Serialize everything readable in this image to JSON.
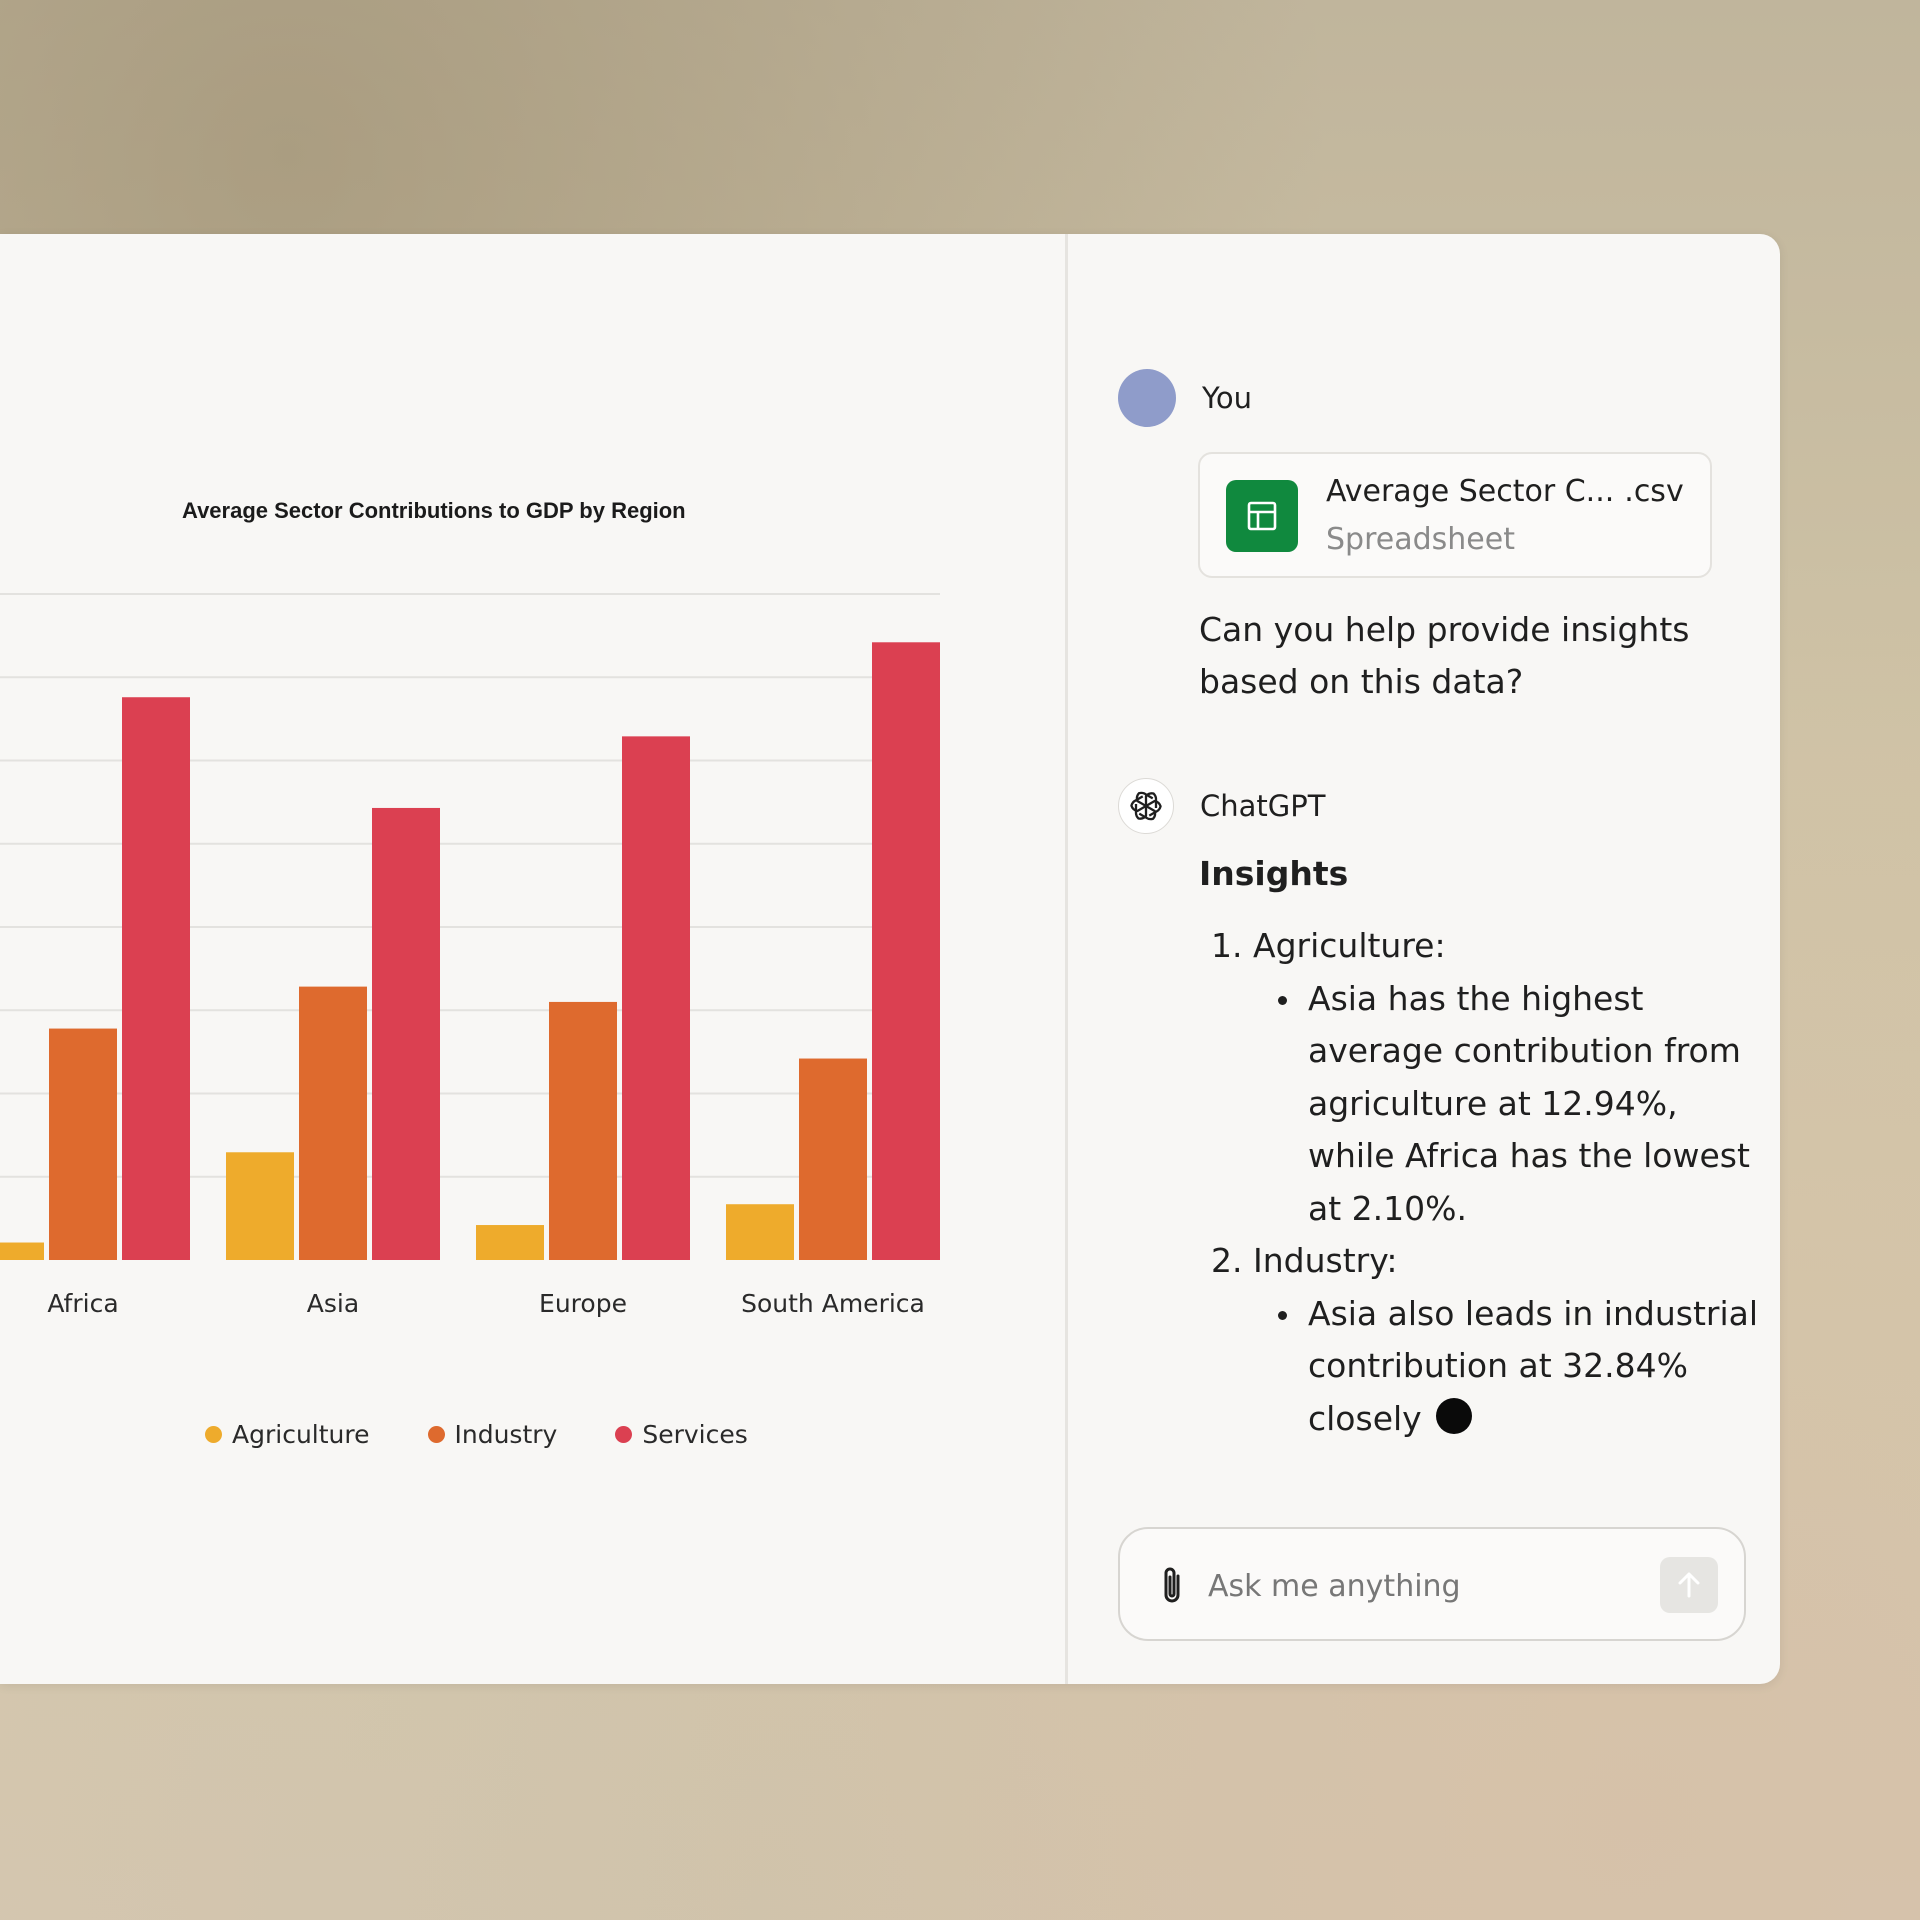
{
  "chart_data": {
    "type": "bar",
    "title": "Average Sector Contributions to GDP by Region",
    "categories": [
      "Africa",
      "Asia",
      "Europe",
      "South America"
    ],
    "series": [
      {
        "name": "Agriculture",
        "color": "#eeab2c",
        "values": [
          2.1,
          12.94,
          4.2,
          6.7
        ]
      },
      {
        "name": "Industry",
        "color": "#de6a2e",
        "values": [
          27.8,
          32.84,
          31.0,
          24.2
        ]
      },
      {
        "name": "Services",
        "color": "#db4051",
        "values": [
          67.6,
          54.3,
          62.9,
          74.2
        ]
      }
    ],
    "ylim": [
      0,
      80
    ],
    "grid": true,
    "legend_position": "bottom"
  },
  "chat": {
    "user": {
      "name": "You",
      "file": {
        "name": "Average Sector C...",
        "extension": ".csv",
        "type": "Spreadsheet",
        "icon": "spreadsheet-icon",
        "icon_color": "#10893e"
      },
      "message": "Can you help provide insights based on this data?"
    },
    "assistant": {
      "name": "ChatGPT",
      "icon": "openai-logo-icon",
      "heading": "Insights",
      "items": [
        {
          "number": "1.",
          "title": "Agriculture:",
          "bullet": "Asia has the highest average contribution from agriculture at 12.94%, while Africa has the lowest at 2.10%."
        },
        {
          "number": "2.",
          "title": "Industry:",
          "bullet": "Asia also leads in industrial contribution at 32.84% closely"
        }
      ]
    },
    "composer": {
      "placeholder": "Ask me anything",
      "attach_icon": "paperclip-icon",
      "send_icon": "arrow-up-icon"
    }
  },
  "colors": {
    "user_avatar": "#8f9cca",
    "panel": "#f8f7f5"
  }
}
